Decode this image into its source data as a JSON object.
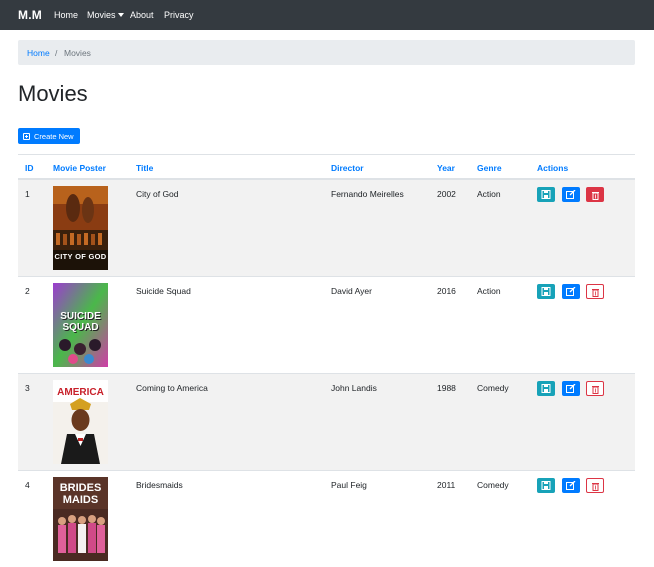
{
  "navbar": {
    "brand": "M.M",
    "links": [
      "Home",
      "Movies",
      "About",
      "Privacy"
    ]
  },
  "breadcrumb": {
    "home": "Home",
    "separator": "/",
    "current": "Movies"
  },
  "page": {
    "title": "Movies",
    "create_button": "Create New"
  },
  "table": {
    "headers": [
      "ID",
      "Movie Poster",
      "Title",
      "Director",
      "Year",
      "Genre",
      "Actions"
    ],
    "rows": [
      {
        "id": "1",
        "title": "City of God",
        "director": "Fernando Meirelles",
        "year": "2002",
        "genre": "Action",
        "poster_text": "CITY OF GOD",
        "poster_icon": "city-of-god-poster-icon"
      },
      {
        "id": "2",
        "title": "Suicide Squad",
        "director": "David Ayer",
        "year": "2016",
        "genre": "Action",
        "poster_text": "SUICIDE SQUAD",
        "poster_icon": "suicide-squad-poster-icon"
      },
      {
        "id": "3",
        "title": "Coming to America",
        "director": "John Landis",
        "year": "1988",
        "genre": "Comedy",
        "poster_text": "AMERICA",
        "poster_icon": "coming-to-america-poster-icon"
      },
      {
        "id": "4",
        "title": "Bridesmaids",
        "director": "Paul Feig",
        "year": "2011",
        "genre": "Comedy",
        "poster_text": "BRIDES MAIDS",
        "poster_icon": "bridesmaids-poster-icon"
      }
    ]
  },
  "colors": {
    "navbar": "#343a40",
    "link": "#007bff",
    "save": "#17a2b8",
    "edit": "#007bff",
    "delete": "#dc3545"
  }
}
